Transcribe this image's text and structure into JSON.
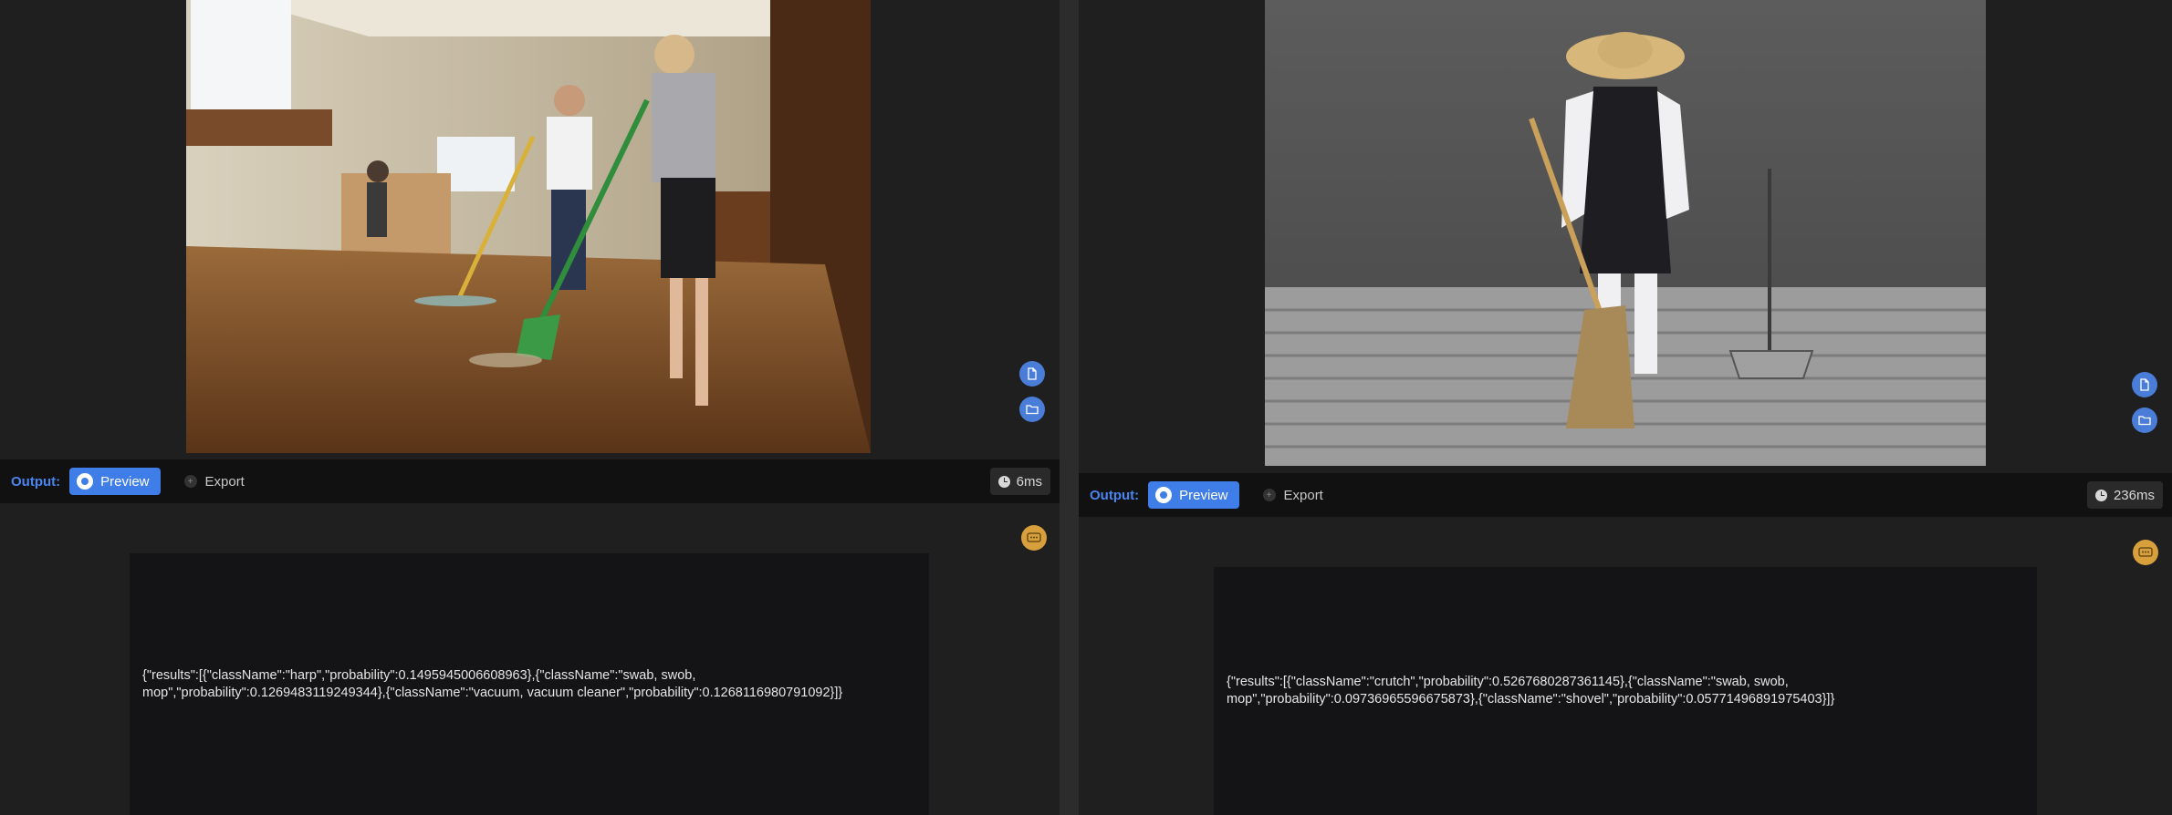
{
  "panels": [
    {
      "id": "left",
      "image_alt": "three people cleaning a kitchen floor with mops and brooms",
      "side_buttons": [
        "file-icon",
        "folder-icon"
      ],
      "output": {
        "label": "Output:",
        "preview_label": "Preview",
        "export_label": "Export",
        "timing": "6ms"
      },
      "result_icon": "chat-bubble-icon",
      "result_text": "{\"results\":[{\"className\":\"harp\",\"probability\":0.1495945006608963},{\"className\":\"swab, swob,\nmop\",\"probability\":0.1269483119249344},{\"className\":\"vacuum, vacuum cleaner\",\"probability\":0.1268116980791092}]}"
    },
    {
      "id": "right",
      "image_alt": "monk in straw hat sweeping stone steps with a broom beside a dustpan",
      "side_buttons": [
        "file-icon",
        "folder-icon"
      ],
      "output": {
        "label": "Output:",
        "preview_label": "Preview",
        "export_label": "Export",
        "timing": "236ms"
      },
      "result_icon": "chat-bubble-icon",
      "result_text": "{\"results\":[{\"className\":\"crutch\",\"probability\":0.5267680287361145},{\"className\":\"swab, swob,\nmop\",\"probability\":0.09736965596675873},{\"className\":\"shovel\",\"probability\":0.05771496891975403}]}"
    }
  ],
  "colors": {
    "accent": "#3f7de8",
    "output_label": "#4a86f0",
    "badge": "#d7a03c",
    "panel_bg": "#1f1f1f",
    "bar_bg": "#111111"
  }
}
